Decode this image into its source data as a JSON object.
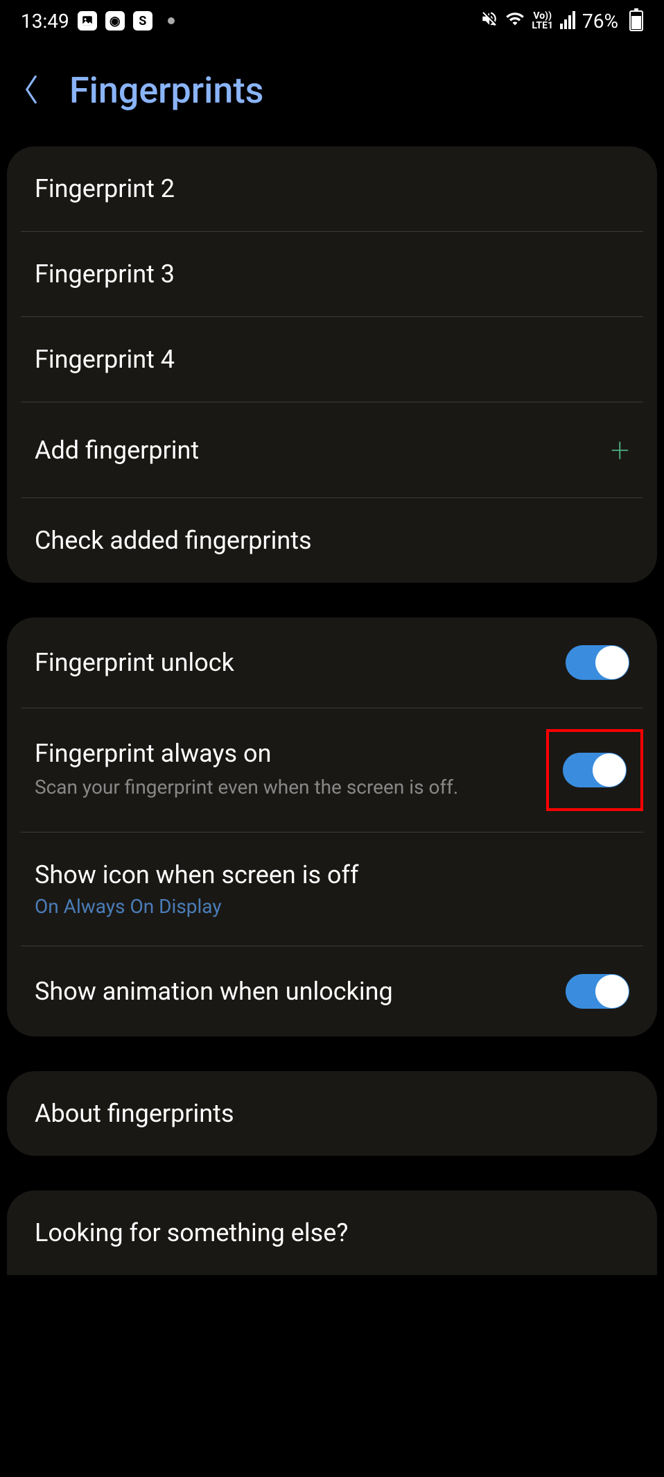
{
  "statusBar": {
    "time": "13:49",
    "battery": "76%",
    "lte": "LTE1",
    "vo": "Vo))"
  },
  "header": {
    "title": "Fingerprints"
  },
  "fingerprints": {
    "items": [
      {
        "label": "Fingerprint 2"
      },
      {
        "label": "Fingerprint 3"
      },
      {
        "label": "Fingerprint 4"
      }
    ],
    "addLabel": "Add fingerprint",
    "checkLabel": "Check added fingerprints"
  },
  "settings": {
    "unlock": {
      "title": "Fingerprint unlock",
      "on": true
    },
    "alwaysOn": {
      "title": "Fingerprint always on",
      "subtitle": "Scan your fingerprint even when the screen is off.",
      "on": true
    },
    "showIcon": {
      "title": "Show icon when screen is off",
      "subtitle": "On Always On Display"
    },
    "showAnimation": {
      "title": "Show animation when unlocking",
      "on": true
    }
  },
  "about": {
    "title": "About fingerprints"
  },
  "search": {
    "title": "Looking for something else?"
  }
}
